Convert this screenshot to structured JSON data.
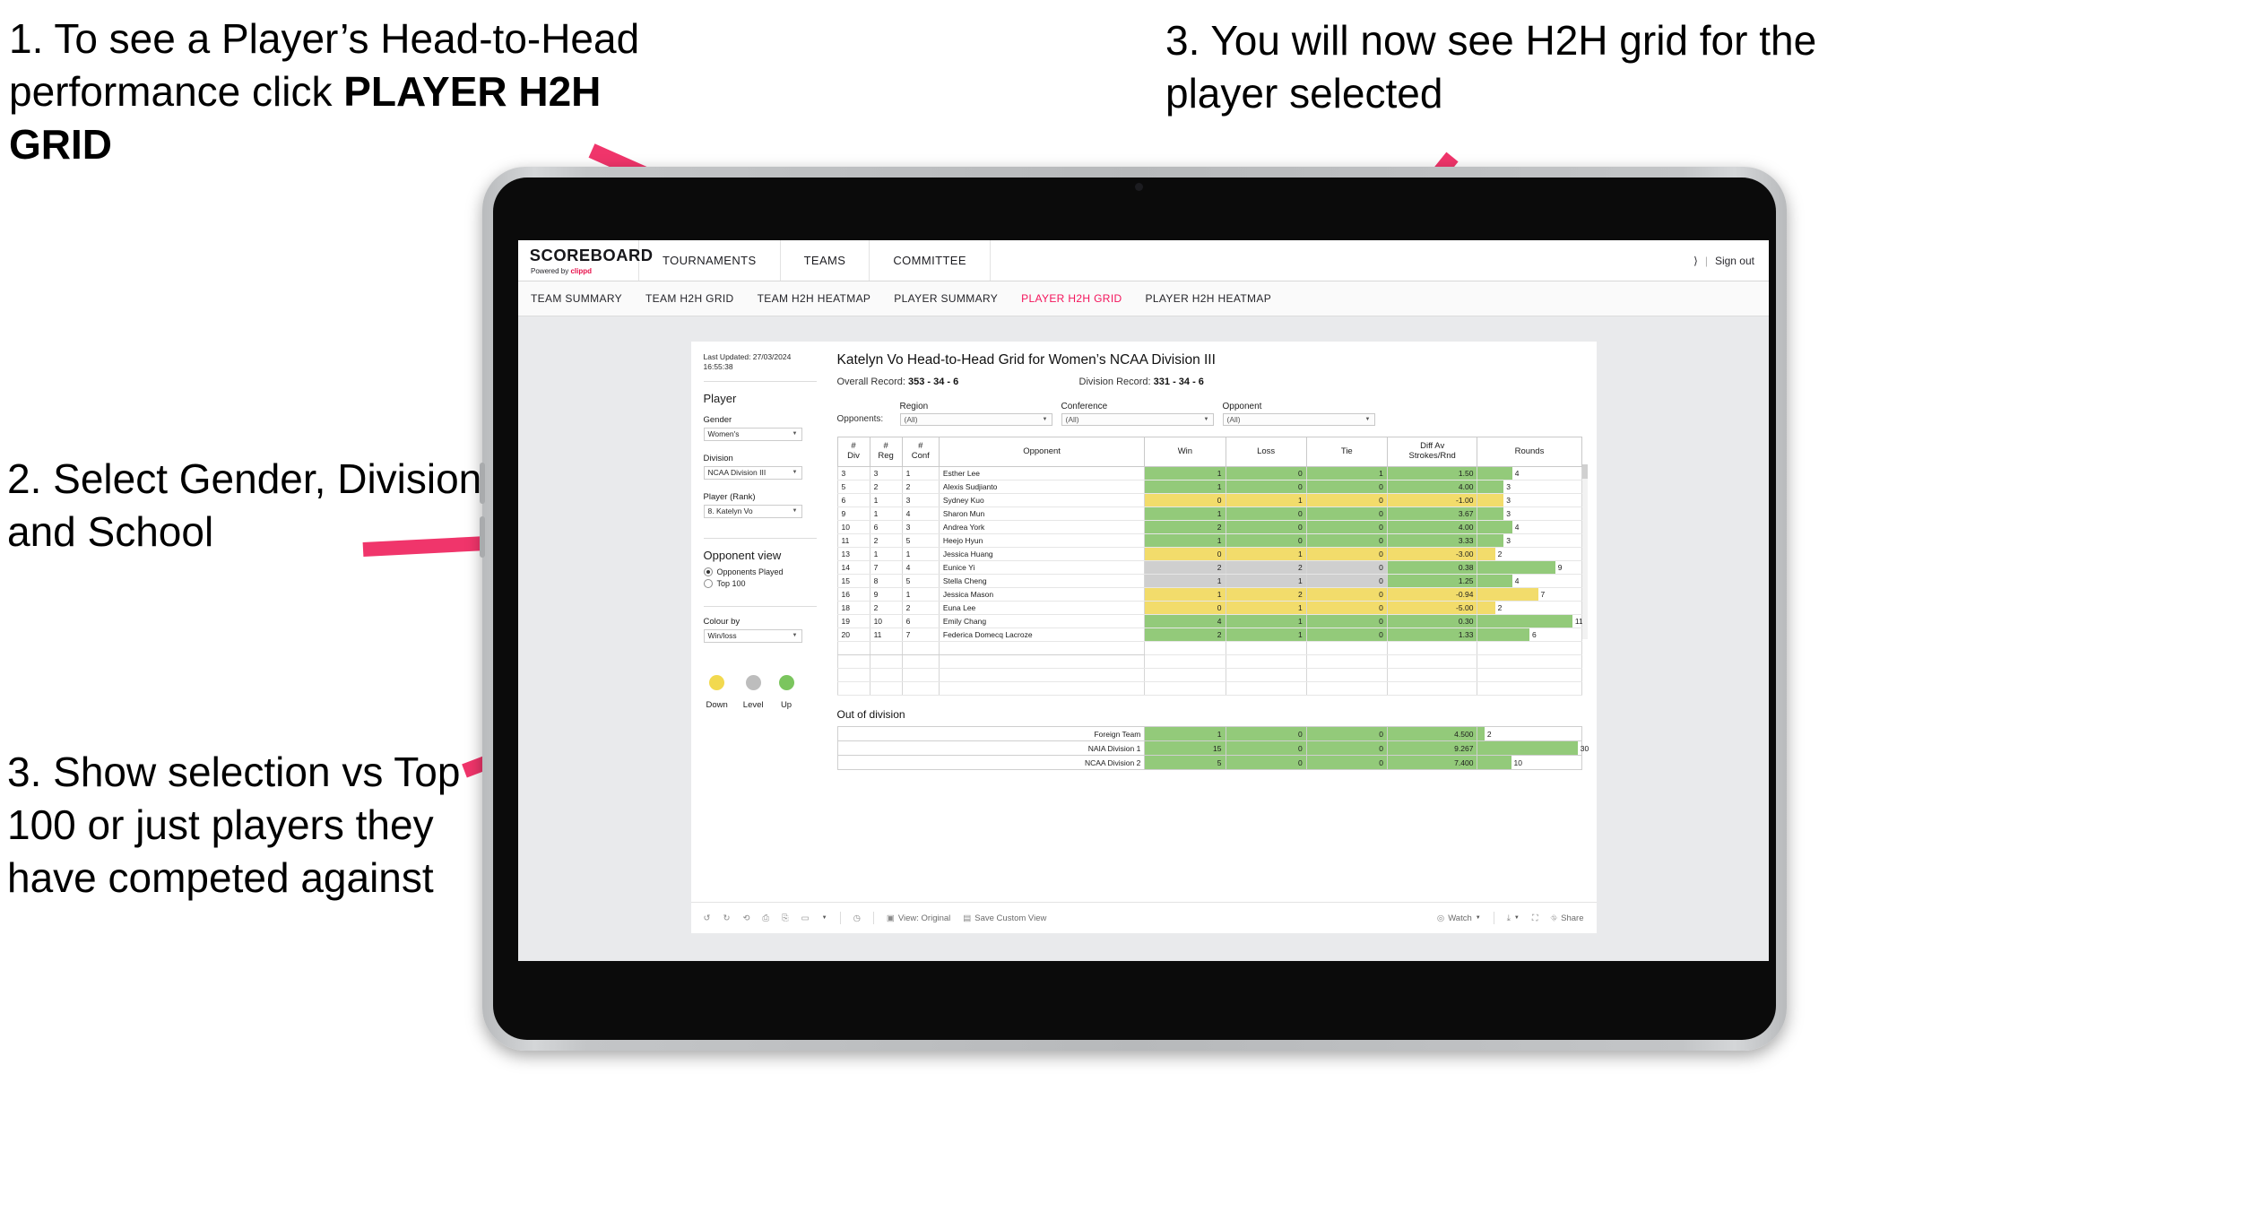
{
  "annotations": {
    "step1_line1": "1. To see a Player’s Head-to-Head performance click ",
    "step1_bold": "PLAYER H2H GRID",
    "step2": "2. Select Gender, Division and School",
    "step3_left": "3. Show selection vs Top 100 or just players they have competed against",
    "step3_right": "3. You will now see H2H grid for the player selected"
  },
  "brand": {
    "name": "SCOREBOARD",
    "powered_prefix": "Powered by ",
    "powered_by": "clippd"
  },
  "topnav": {
    "items": [
      "TOURNAMENTS",
      "TEAMS",
      "COMMITTEE"
    ],
    "account_glyph": "⟩",
    "separator": "|",
    "sign_out": "Sign out"
  },
  "subnav": {
    "items": [
      "TEAM SUMMARY",
      "TEAM H2H GRID",
      "TEAM H2H HEATMAP",
      "PLAYER SUMMARY",
      "PLAYER H2H GRID",
      "PLAYER H2H HEATMAP"
    ],
    "active_index": 4,
    "active_color": "#f4145b"
  },
  "filters": {
    "last_updated_label": "Last Updated: 27/03/2024",
    "last_updated_time": "16:55:38",
    "section_title": "Player",
    "gender_label": "Gender",
    "gender_value": "Women's",
    "division_label": "Division",
    "division_value": "NCAA Division III",
    "player_label": "Player (Rank)",
    "player_value": "8. Katelyn Vo",
    "opponent_view_title": "Opponent view",
    "opponent_view_options": [
      "Opponents Played",
      "Top 100"
    ],
    "opponent_view_selected": 0,
    "colour_by_label": "Colour by",
    "colour_by_value": "Win/loss",
    "legend": [
      {
        "label": "Down",
        "color": "#f2d94f"
      },
      {
        "label": "Level",
        "color": "#bdbdbd"
      },
      {
        "label": "Up",
        "color": "#7bc55e"
      }
    ]
  },
  "viz": {
    "title": "Katelyn Vo Head-to-Head Grid for Women’s NCAA Division III",
    "overall_record_label": "Overall Record:",
    "overall_record_value": "353 -  34 - 6",
    "division_record_label": "Division Record:",
    "division_record_value": "331 -  34 - 6",
    "opponents_label": "Opponents:",
    "opponent_filters": [
      {
        "label": "Region",
        "value": "(All)"
      },
      {
        "label": "Conference",
        "value": "(All)"
      },
      {
        "label": "Opponent",
        "value": "(All)"
      }
    ]
  },
  "chart_data": {
    "type": "table",
    "title": "Katelyn Vo Head-to-Head Grid for Women’s NCAA Division III",
    "columns": [
      "# Div",
      "# Reg",
      "# Conf",
      "Opponent",
      "Win",
      "Loss",
      "Tie",
      "Diff Av Strokes/Rnd",
      "Rounds"
    ],
    "column_headers_two_line": [
      [
        "#",
        "Div"
      ],
      [
        "#",
        "Reg"
      ],
      [
        "#",
        "Conf"
      ],
      [
        "Opponent",
        ""
      ],
      [
        "Win",
        ""
      ],
      [
        "Loss",
        ""
      ],
      [
        "Tie",
        ""
      ],
      [
        "Diff Av",
        "Strokes/Rnd"
      ],
      [
        "Rounds",
        ""
      ]
    ],
    "rows": [
      {
        "div": "3",
        "reg": "3",
        "conf": "1",
        "opponent": "Esther Lee",
        "win": "1",
        "loss": "0",
        "tie": "1",
        "diff": "1.50",
        "rounds": 4,
        "state": "up"
      },
      {
        "div": "5",
        "reg": "2",
        "conf": "2",
        "opponent": "Alexis Sudjianto",
        "win": "1",
        "loss": "0",
        "tie": "0",
        "diff": "4.00",
        "rounds": 3,
        "state": "up"
      },
      {
        "div": "6",
        "reg": "1",
        "conf": "3",
        "opponent": "Sydney Kuo",
        "win": "0",
        "loss": "1",
        "tie": "0",
        "diff": "-1.00",
        "rounds": 3,
        "state": "down"
      },
      {
        "div": "9",
        "reg": "1",
        "conf": "4",
        "opponent": "Sharon Mun",
        "win": "1",
        "loss": "0",
        "tie": "0",
        "diff": "3.67",
        "rounds": 3,
        "state": "up"
      },
      {
        "div": "10",
        "reg": "6",
        "conf": "3",
        "opponent": "Andrea York",
        "win": "2",
        "loss": "0",
        "tie": "0",
        "diff": "4.00",
        "rounds": 4,
        "state": "up"
      },
      {
        "div": "11",
        "reg": "2",
        "conf": "5",
        "opponent": "Heejo Hyun",
        "win": "1",
        "loss": "0",
        "tie": "0",
        "diff": "3.33",
        "rounds": 3,
        "state": "up"
      },
      {
        "div": "13",
        "reg": "1",
        "conf": "1",
        "opponent": "Jessica Huang",
        "win": "0",
        "loss": "1",
        "tie": "0",
        "diff": "-3.00",
        "rounds": 2,
        "state": "down"
      },
      {
        "div": "14",
        "reg": "7",
        "conf": "4",
        "opponent": "Eunice Yi",
        "win": "2",
        "loss": "2",
        "tie": "0",
        "diff": "0.38",
        "rounds": 9,
        "state": "level",
        "diff_state": "up"
      },
      {
        "div": "15",
        "reg": "8",
        "conf": "5",
        "opponent": "Stella Cheng",
        "win": "1",
        "loss": "1",
        "tie": "0",
        "diff": "1.25",
        "rounds": 4,
        "state": "level",
        "diff_state": "up"
      },
      {
        "div": "16",
        "reg": "9",
        "conf": "1",
        "opponent": "Jessica Mason",
        "win": "1",
        "loss": "2",
        "tie": "0",
        "diff": "-0.94",
        "rounds": 7,
        "state": "down"
      },
      {
        "div": "18",
        "reg": "2",
        "conf": "2",
        "opponent": "Euna Lee",
        "win": "0",
        "loss": "1",
        "tie": "0",
        "diff": "-5.00",
        "rounds": 2,
        "state": "down"
      },
      {
        "div": "19",
        "reg": "10",
        "conf": "6",
        "opponent": "Emily Chang",
        "win": "4",
        "loss": "1",
        "tie": "0",
        "diff": "0.30",
        "rounds": 11,
        "state": "up"
      },
      {
        "div": "20",
        "reg": "11",
        "conf": "7",
        "opponent": "Federica Domecq Lacroze",
        "win": "2",
        "loss": "1",
        "tie": "0",
        "diff": "1.33",
        "rounds": 6,
        "state": "up"
      }
    ],
    "rounds_max": 12,
    "out_of_division": {
      "title": "Out of division",
      "rows": [
        {
          "name": "Foreign Team",
          "win": "1",
          "loss": "0",
          "tie": "0",
          "diff": "4.500",
          "rounds": 2,
          "state": "up"
        },
        {
          "name": "NAIA Division 1",
          "win": "15",
          "loss": "0",
          "tie": "0",
          "diff": "9.267",
          "rounds": 30,
          "state": "up"
        },
        {
          "name": "NCAA Division 2",
          "win": "5",
          "loss": "0",
          "tie": "0",
          "diff": "7.400",
          "rounds": 10,
          "state": "up"
        }
      ],
      "rounds_max": 31
    },
    "colors": {
      "up": "#93ca7a",
      "down": "#f2dc6b",
      "level": "#cfcfcf"
    }
  },
  "toolbar": {
    "view_original": "View: Original",
    "save_custom_view": "Save Custom View",
    "watch": "Watch",
    "share": "Share"
  }
}
